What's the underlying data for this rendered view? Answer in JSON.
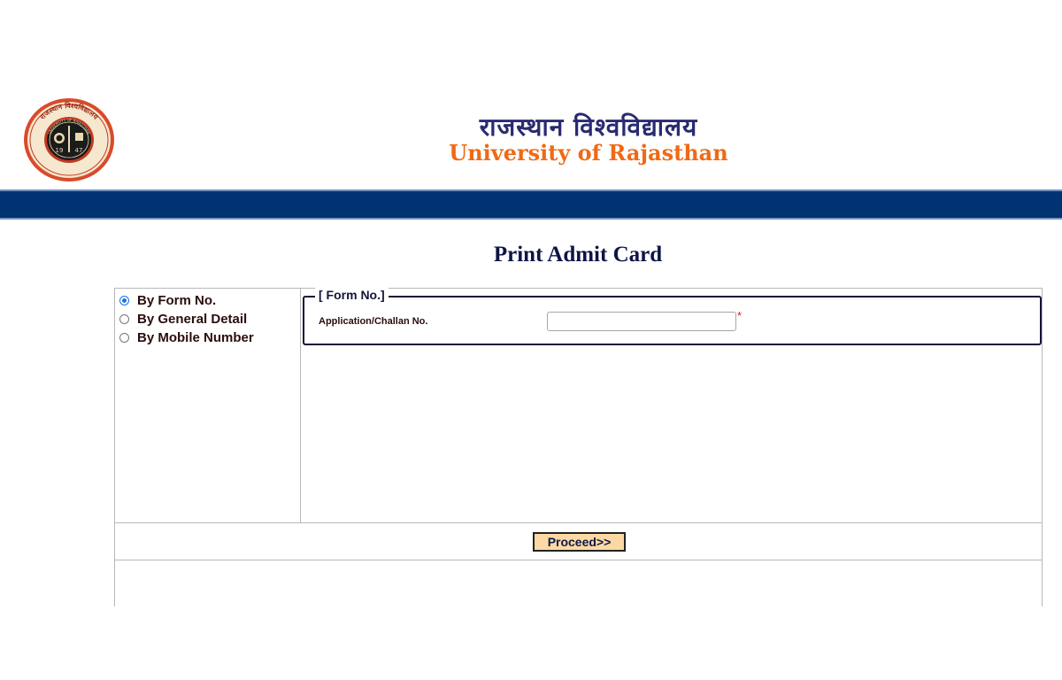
{
  "header": {
    "title_hindi": "राजस्थान विश्वविद्यालय",
    "title_english": "University of Rajasthan",
    "logo": {
      "icon": "university-seal-icon",
      "seal_text_outer": "राजस्थान विश्वविद्यालय",
      "seal_text_inner": "UNIVERSITY OF RAJASTHAN",
      "year_left": "19",
      "year_right": "47"
    },
    "colors": {
      "hindi": "#2a2a72",
      "english": "#ef6a16",
      "bar": "#003371"
    }
  },
  "page": {
    "title": "Print Admit Card"
  },
  "search_options": [
    {
      "label": "By Form No.",
      "selected": true
    },
    {
      "label": "By General Detail",
      "selected": false
    },
    {
      "label": "By Mobile Number",
      "selected": false
    }
  ],
  "form_section": {
    "legend": "[ Form No.]",
    "field_label": "Application/Challan No.",
    "field_value": "",
    "required_marker": "*"
  },
  "actions": {
    "proceed_label": "Proceed>>"
  }
}
